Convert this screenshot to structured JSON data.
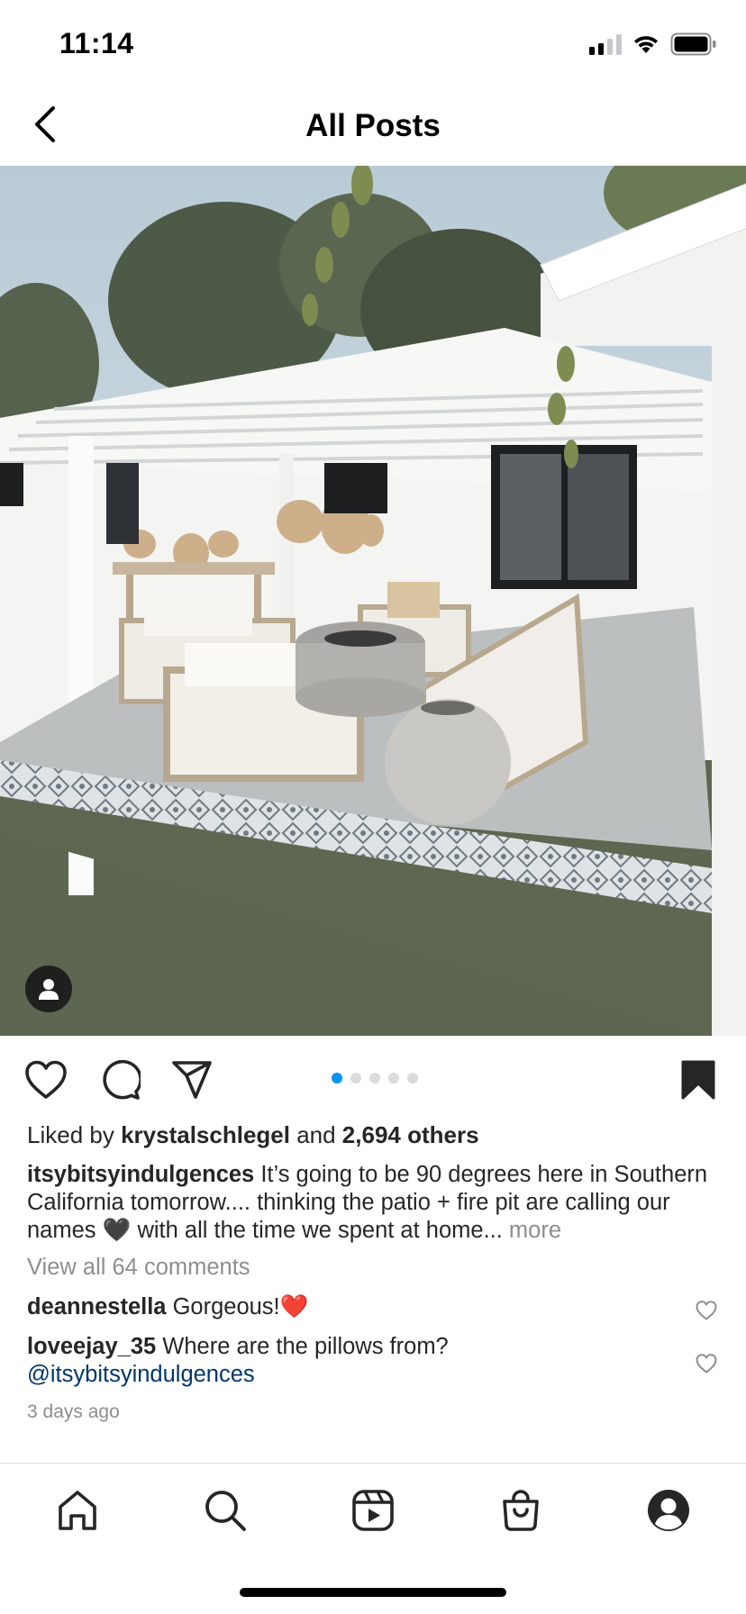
{
  "status_bar": {
    "time": "11:14",
    "icons": [
      "signal-icon",
      "wifi-icon",
      "battery-icon"
    ]
  },
  "header": {
    "title": "All Posts",
    "back_icon": "chevron-left-icon"
  },
  "post": {
    "image_alt": "patio-photo",
    "tag_icon": "user-tag-icon",
    "carousel": {
      "count": 5,
      "active_index": 0
    },
    "actions": [
      "heart-icon",
      "comment-icon",
      "share-icon",
      "bookmark-icon"
    ],
    "likes": {
      "prefix": "Liked by ",
      "user": "krystalschlegel",
      "middle": " and ",
      "others": "2,694 others"
    },
    "caption": {
      "username": "itsybitsyindulgences",
      "text": " It’s going to be 90 degrees here in Southern California tomorrow.... thinking the patio + fire pit are calling our names 🖤 with all the time we spent at home...",
      "more": " more"
    },
    "view_comments": "View all 64 comments",
    "comments": [
      {
        "username": "deannestella",
        "text": " Gorgeous!❤️"
      },
      {
        "username": "loveejay_35",
        "text": " Where are the pillows from? ",
        "mention": "@itsybitsyindulgences"
      }
    ],
    "time_ago": "3 days ago"
  },
  "bottom_nav": {
    "items": [
      "home-icon",
      "search-icon",
      "reels-icon",
      "shop-icon",
      "profile-icon"
    ]
  },
  "colors": {
    "accent": "#0095f6",
    "text": "#262626",
    "secondary": "#8e8e8e",
    "mention": "#00376b"
  }
}
